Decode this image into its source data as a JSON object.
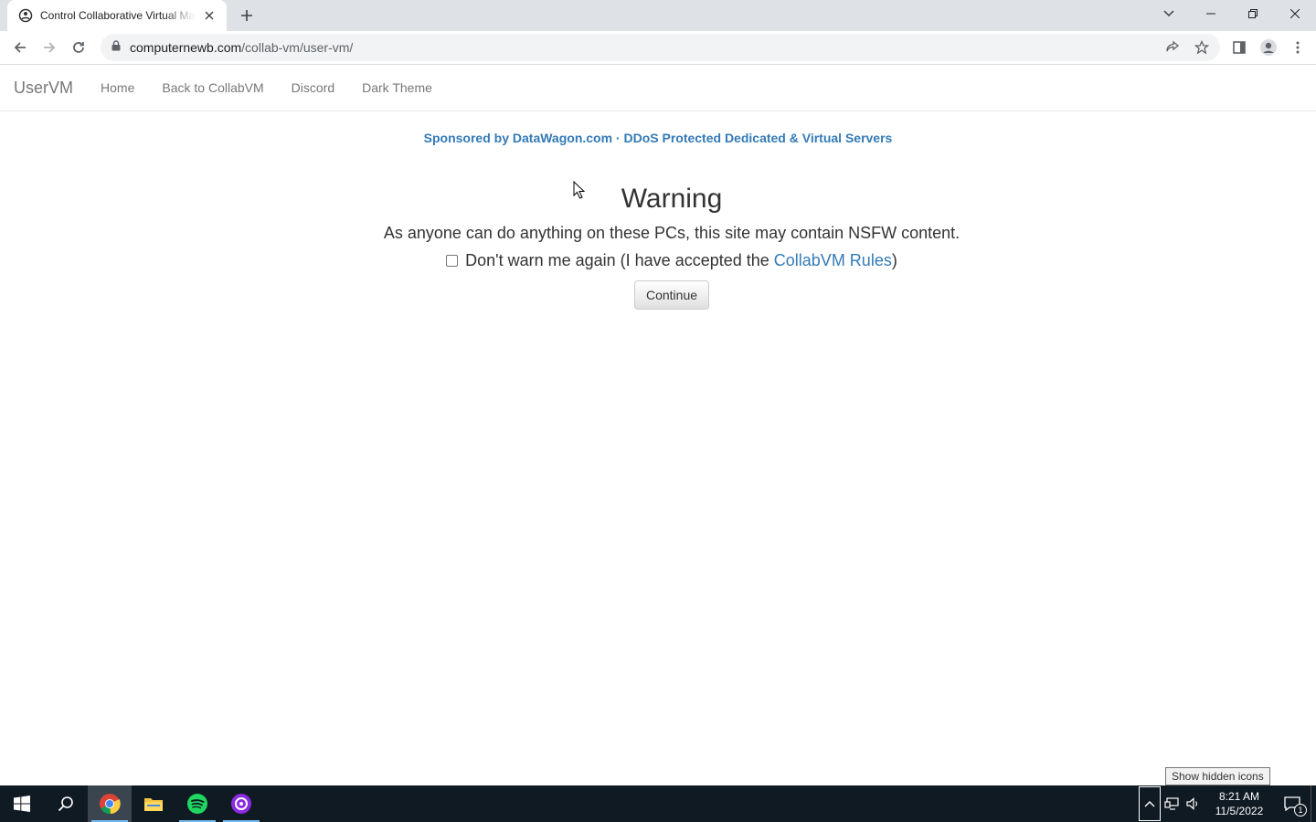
{
  "browser": {
    "tab_title": "Control Collaborative Virtual Machines",
    "url_host": "computernewb.com",
    "url_path": "/collab-vm/user-vm/"
  },
  "navbar": {
    "brand": "UserVM",
    "links": [
      "Home",
      "Back to CollabVM",
      "Discord",
      "Dark Theme"
    ]
  },
  "page": {
    "sponsor": "Sponsored by DataWagon.com · DDoS Protected Dedicated & Virtual Servers",
    "warning_title": "Warning",
    "warning_text": "As anyone can do anything on these PCs, this site may contain NSFW content.",
    "accept_prefix": "Don't warn me again (I have accepted the ",
    "accept_link": "CollabVM Rules",
    "accept_suffix": ")",
    "continue_label": "Continue",
    "link_color": "#337ab7"
  },
  "taskbar": {
    "time": "8:21 AM",
    "date": "11/5/2022",
    "tooltip": "Show hidden icons",
    "notifications": "1",
    "apps": [
      "start-icon",
      "search-icon",
      "chrome-icon",
      "file-explorer-icon",
      "spotify-icon",
      "podcast-app-icon"
    ]
  }
}
